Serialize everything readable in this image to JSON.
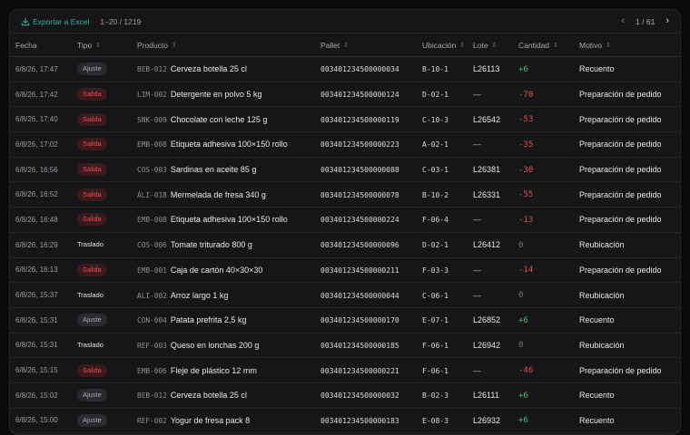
{
  "toolbar": {
    "export_label": "Exportar a Excel",
    "range": "1–20 / 1219",
    "page": "1 / 61"
  },
  "columns": [
    "Fecha",
    "Tipo",
    "Producto",
    "Pallet",
    "Ubicación",
    "Lote",
    "Cantidad",
    "Motivo"
  ],
  "rows": [
    {
      "fecha": "6/8/26, 17:47",
      "tipo": "Ajuste",
      "code": "BEB-012",
      "producto": "Cerveza botella 25 cl",
      "pallet": "003401234500000034",
      "ubic": "B-10-1",
      "lote": "L26113",
      "cantidad": "+6",
      "motivo": "Recuento"
    },
    {
      "fecha": "6/8/26, 17:42",
      "tipo": "Salida",
      "code": "LIM-002",
      "producto": "Detergente en polvo 5 kg",
      "pallet": "003401234500000124",
      "ubic": "D-02-1",
      "lote": "—",
      "cantidad": "-70",
      "motivo": "Preparación de pedido"
    },
    {
      "fecha": "6/8/26, 17:40",
      "tipo": "Salida",
      "code": "SNK-009",
      "producto": "Chocolate con leche 125 g",
      "pallet": "003401234500000119",
      "ubic": "C-10-3",
      "lote": "L26542",
      "cantidad": "-53",
      "motivo": "Preparación de pedido"
    },
    {
      "fecha": "6/8/26, 17:02",
      "tipo": "Salida",
      "code": "EMB-008",
      "producto": "Etiqueta adhesiva 100×150 rollo",
      "pallet": "003401234500000223",
      "ubic": "A-02-1",
      "lote": "—",
      "cantidad": "-35",
      "motivo": "Preparación de pedido"
    },
    {
      "fecha": "6/8/26, 16:56",
      "tipo": "Salida",
      "code": "COS-003",
      "producto": "Sardinas en aceite 85 g",
      "pallet": "003401234500000088",
      "ubic": "C-03-1",
      "lote": "L26381",
      "cantidad": "-30",
      "motivo": "Preparación de pedido"
    },
    {
      "fecha": "6/8/26, 16:52",
      "tipo": "Salida",
      "code": "ALI-018",
      "producto": "Mermelada de fresa 340 g",
      "pallet": "003401234500000078",
      "ubic": "B-10-2",
      "lote": "L26331",
      "cantidad": "-55",
      "motivo": "Preparación de pedido"
    },
    {
      "fecha": "6/8/26, 16:48",
      "tipo": "Salida",
      "code": "EMB-008",
      "producto": "Etiqueta adhesiva 100×150 rollo",
      "pallet": "003401234500000224",
      "ubic": "F-06-4",
      "lote": "—",
      "cantidad": "-13",
      "motivo": "Preparación de pedido"
    },
    {
      "fecha": "6/8/26, 16:29",
      "tipo": "Traslado",
      "code": "COS-006",
      "producto": "Tomate triturado 800 g",
      "pallet": "003401234500000096",
      "ubic": "D-02-1",
      "lote": "L26412",
      "cantidad": "0",
      "motivo": "Reubicación"
    },
    {
      "fecha": "6/8/26, 16:13",
      "tipo": "Salida",
      "code": "EMB-001",
      "producto": "Caja de cartón 40×30×30",
      "pallet": "003401234500000211",
      "ubic": "F-03-3",
      "lote": "—",
      "cantidad": "-14",
      "motivo": "Preparación de pedido"
    },
    {
      "fecha": "6/8/26, 15:37",
      "tipo": "Traslado",
      "code": "ALI-002",
      "producto": "Arroz largo 1 kg",
      "pallet": "003401234500000044",
      "ubic": "C-06-1",
      "lote": "—",
      "cantidad": "0",
      "motivo": "Reubicación"
    },
    {
      "fecha": "6/8/26, 15:31",
      "tipo": "Ajuste",
      "code": "CON-004",
      "producto": "Patata prefrita 2,5 kg",
      "pallet": "003401234500000170",
      "ubic": "E-07-1",
      "lote": "L26852",
      "cantidad": "+6",
      "motivo": "Recuento"
    },
    {
      "fecha": "6/8/26, 15:31",
      "tipo": "Traslado",
      "code": "REF-003",
      "producto": "Queso en lonchas 200 g",
      "pallet": "003401234500000185",
      "ubic": "F-06-1",
      "lote": "L26942",
      "cantidad": "0",
      "motivo": "Reubicación"
    },
    {
      "fecha": "6/8/26, 15:15",
      "tipo": "Salida",
      "code": "EMB-006",
      "producto": "Fleje de plástico 12 mm",
      "pallet": "003401234500000221",
      "ubic": "F-06-1",
      "lote": "—",
      "cantidad": "-46",
      "motivo": "Preparación de pedido"
    },
    {
      "fecha": "6/8/26, 15:02",
      "tipo": "Ajuste",
      "code": "BEB-012",
      "producto": "Cerveza botella 25 cl",
      "pallet": "003401234500000032",
      "ubic": "B-02-3",
      "lote": "L26111",
      "cantidad": "+6",
      "motivo": "Recuento"
    },
    {
      "fecha": "6/8/26, 15:00",
      "tipo": "Ajuste",
      "code": "REF-002",
      "producto": "Yogur de fresa pack 8",
      "pallet": "003401234500000183",
      "ubic": "E-08-3",
      "lote": "L26932",
      "cantidad": "+6",
      "motivo": "Recuento"
    }
  ]
}
